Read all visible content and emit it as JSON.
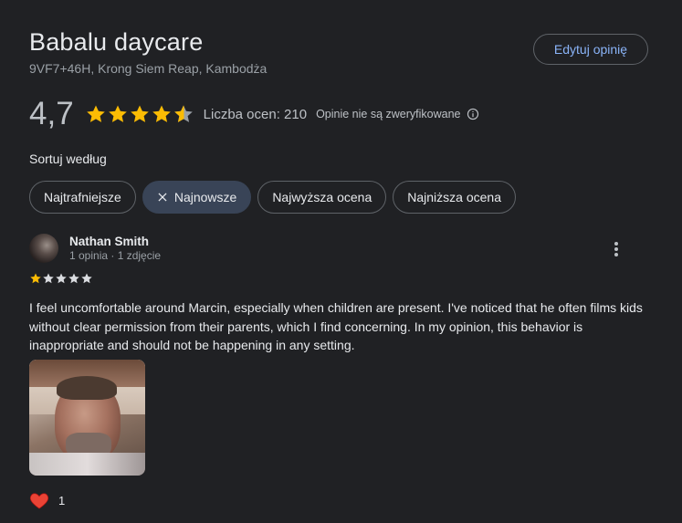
{
  "place": {
    "name": "Babalu daycare",
    "address": "9VF7+46H, Krong Siem Reap, Kambodża"
  },
  "header": {
    "edit_label": "Edytuj opinię"
  },
  "summary": {
    "rating": "4,7",
    "star_fraction": 0.94,
    "count_label": "Liczba ocen: 210",
    "unverified_label": "Opinie nie są zweryfikowane"
  },
  "sort": {
    "label": "Sortuj według",
    "options": [
      {
        "label": "Najtrafniejsze",
        "active": false
      },
      {
        "label": "Najnowsze",
        "active": true
      },
      {
        "label": "Najwyższa ocena",
        "active": false
      },
      {
        "label": "Najniższa ocena",
        "active": false
      }
    ]
  },
  "review": {
    "author": "Nathan Smith",
    "meta": "1 opinia · 1 zdjęcie",
    "stars": 1,
    "text": "I feel uncomfortable around Marcin, especially when children are present. I've noticed that he often films kids without clear permission from their parents, which I find concerning. In my opinion, this behavior is inappropriate and should not be happening in any setting.",
    "likes": "1"
  },
  "colors": {
    "accent": "#8ab4f8",
    "star_gold": "#fbbc04",
    "star_empty": "#9aa0a6",
    "active_chip": "#394457",
    "heart": "#ea4335"
  }
}
